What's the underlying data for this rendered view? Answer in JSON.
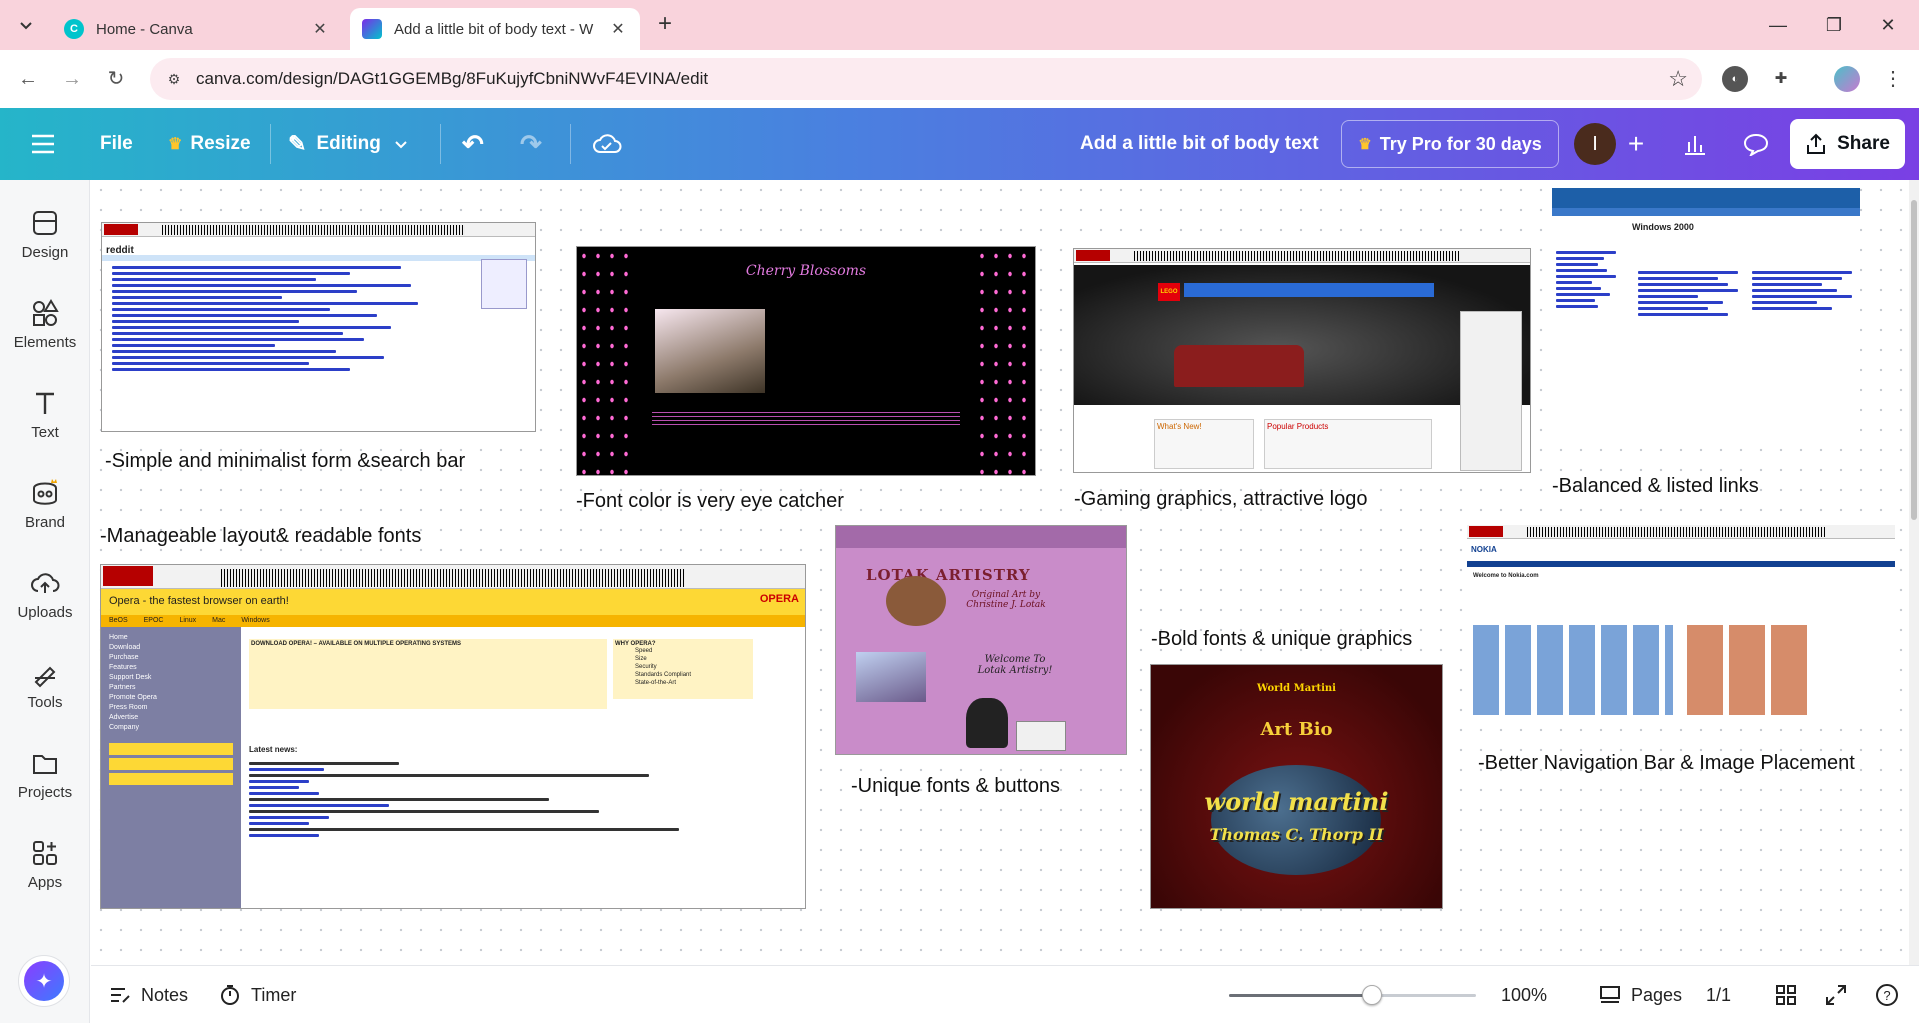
{
  "browser": {
    "tabs": [
      {
        "title": "Home - Canva",
        "active": false,
        "favicon_color": "#00c4cc"
      },
      {
        "title": "Add a little bit of body text - W",
        "active": true,
        "favicon_color": "#7d2ae8"
      }
    ],
    "url": "canva.com/design/DAGt1GGEMBg/8FuKujyfCbniNWvF4EVINA/edit"
  },
  "toolbar": {
    "file_label": "File",
    "resize_label": "Resize",
    "editing_label": "Editing",
    "doc_title": "Add a little bit of body text",
    "pro_label": "Try Pro for 30 days",
    "avatar_initial": "I",
    "share_label": "Share"
  },
  "sidebar": {
    "items": [
      {
        "label": "Design",
        "icon": "design-icon"
      },
      {
        "label": "Elements",
        "icon": "elements-icon"
      },
      {
        "label": "Text",
        "icon": "text-icon"
      },
      {
        "label": "Brand",
        "icon": "brand-icon"
      },
      {
        "label": "Uploads",
        "icon": "uploads-icon"
      },
      {
        "label": "Tools",
        "icon": "tools-icon"
      },
      {
        "label": "Projects",
        "icon": "projects-icon"
      },
      {
        "label": "Apps",
        "icon": "apps-icon"
      }
    ]
  },
  "canvas": {
    "captions": {
      "reddit": "-Simple and minimalist form &search bar",
      "cherry": "-Font color is very eye catcher",
      "lego": "-Gaming graphics, attractive logo",
      "microsoft": "-Balanced & listed links",
      "opera": "-Manageable layout& readable fonts",
      "lotak": "-Unique fonts & buttons",
      "martini": "-Bold fonts & unique graphics",
      "nokia": "-Better Navigation Bar & Image Placement"
    },
    "screenshots": {
      "cherry_title": "Cherry Blossoms",
      "opera_header": "Opera - the fastest browser on earth!",
      "opera_nav": [
        "BeOS",
        "EPOC",
        "Linux",
        "Mac",
        "Windows"
      ],
      "opera_side": [
        "Home",
        "Download",
        "Purchase",
        "Features",
        "Support Desk",
        "Partners",
        "Promote Opera",
        "Press Room",
        "Advertise",
        "Company"
      ],
      "opera_download_title": "DOWNLOAD OPERA! – AVAILABLE ON MULTIPLE OPERATING SYSTEMS",
      "opera_why_title": "WHY OPERA?",
      "opera_why": [
        "Speed",
        "Size",
        "Security",
        "Standards Compliant",
        "State-of-the-Art"
      ],
      "opera_news": "Latest news:",
      "opera_logo": "OPERA",
      "lotak_title": "LOTAK ARTISTRY",
      "lotak_sub": "Original Art by Christine J. Lotak",
      "lotak_welcome": "Welcome To Lotak Artistry!",
      "martini_top": "World Martini",
      "martini_mid": "Art Bio",
      "martini_big": "world martini",
      "martini_name": "Thomas C. Thorp II",
      "microsoft_title": "Windows 2000",
      "lego_logo": "LEGO",
      "lego_new": "What's New!",
      "lego_popular": "Popular Products",
      "nokia_logo": "NOKIA",
      "nokia_welcome": "Welcome to Nokia.com",
      "reddit_logo": "reddit"
    }
  },
  "bottombar": {
    "notes_label": "Notes",
    "timer_label": "Timer",
    "zoom": "100%",
    "zoom_fraction": 0.58,
    "pages_label": "Pages",
    "page_count": "1/1"
  }
}
